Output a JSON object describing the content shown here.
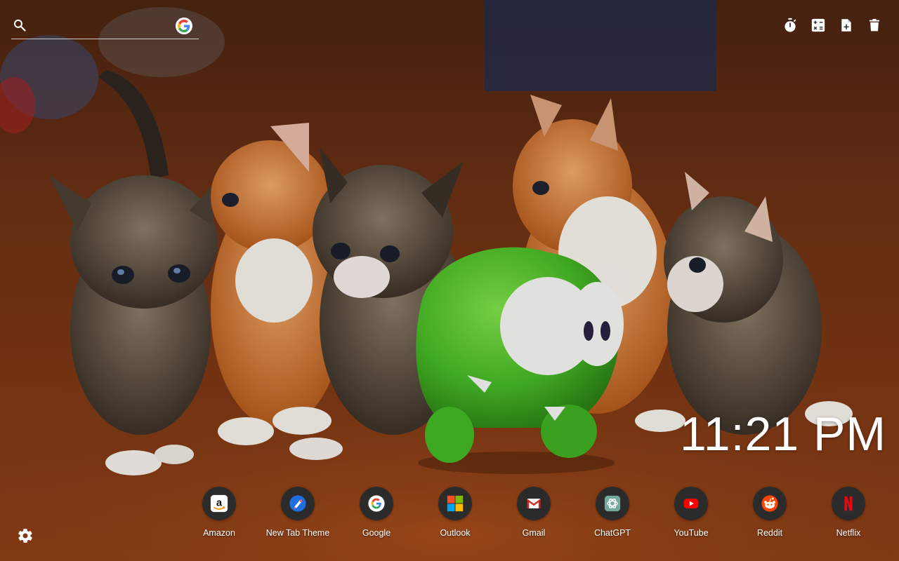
{
  "search": {
    "placeholder": "",
    "value": "",
    "engine_icon": "google-g-icon"
  },
  "toolbar": {
    "items": [
      {
        "icon": "stopwatch-icon"
      },
      {
        "icon": "calculator-icon"
      },
      {
        "icon": "add-note-icon"
      },
      {
        "icon": "trash-icon"
      }
    ]
  },
  "clock": {
    "time": "11:21 PM"
  },
  "shortcuts": [
    {
      "label": "Amazon",
      "icon": "amazon-icon"
    },
    {
      "label": "New Tab Theme",
      "icon": "new-tab-theme-icon"
    },
    {
      "label": "Google",
      "icon": "google-icon"
    },
    {
      "label": "Outlook",
      "icon": "microsoft-icon"
    },
    {
      "label": "Gmail",
      "icon": "gmail-icon"
    },
    {
      "label": "ChatGPT",
      "icon": "chatgpt-icon"
    },
    {
      "label": "YouTube",
      "icon": "youtube-icon"
    },
    {
      "label": "Reddit",
      "icon": "reddit-icon"
    },
    {
      "label": "Netflix",
      "icon": "netflix-icon"
    }
  ],
  "settings": {
    "icon": "gear-icon"
  },
  "background": {
    "subject": "kittens-with-green-toy",
    "colors": {
      "floor": "#8a3d14",
      "wall": "#5a2a12",
      "toy": "#4fc22c"
    }
  }
}
